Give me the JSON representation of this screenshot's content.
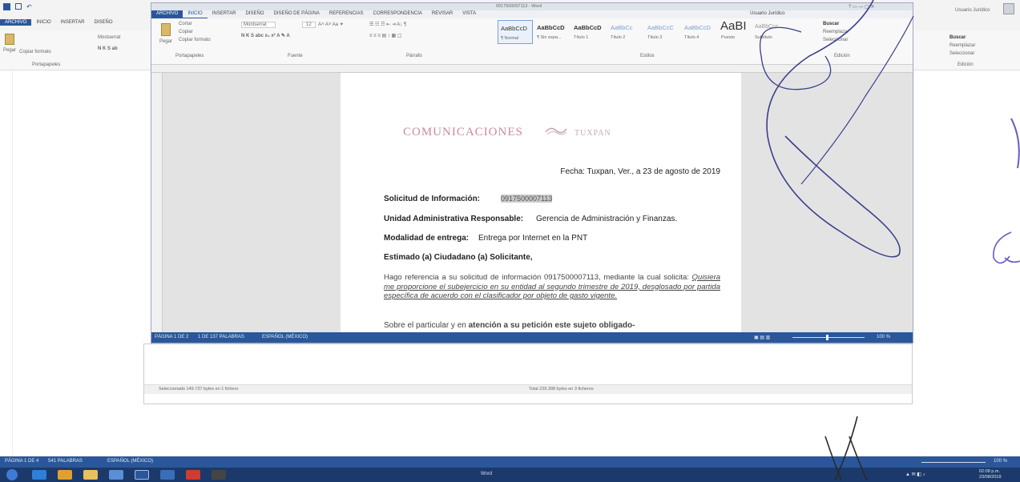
{
  "outer": {
    "tabs": [
      "ARCHIVO",
      "INICIO",
      "INSERTAR",
      "DISEÑO"
    ],
    "ribbon": {
      "paste_label": "Pegar",
      "copy_format_label": "Copiar formato",
      "font_name": "Mostserrat",
      "clipboard_group": "Portapapeles"
    },
    "right_panel": {
      "user": "Usuario Jurídico",
      "find_label": "Buscar",
      "replace_label": "Reemplazar",
      "select_label": "Seleccionar",
      "edit_group": "Edición"
    },
    "status_left": [
      "PÁGINA 1 DE 4",
      "541 PALABRAS",
      "ESPAÑOL (MÉXICO)"
    ],
    "status_right": "100 %",
    "clock": {
      "time": "02:08 p.m.",
      "date": "23/08/2019"
    },
    "taskbar_center": "Word"
  },
  "inner": {
    "window_title": "0917500007113 - Word",
    "user": "Usuario Jurídico",
    "tabs": [
      "ARCHIVO",
      "INICIO",
      "INSERTAR",
      "DISEÑO",
      "DISEÑO DE PÁGINA",
      "REFERENCIAS",
      "CORRESPONDENCIA",
      "REVISAR",
      "VISTA"
    ],
    "ribbon": {
      "paste_label": "Pegar",
      "cut_label": "Cortar",
      "copy_label": "Copiar",
      "copy_format_label": "Copiar formato",
      "font_name": "Montserrat",
      "font_size": "12",
      "clipboard_group": "Portapapeles",
      "font_group": "Fuente",
      "paragraph_group": "Párrafo",
      "styles_group": "Estilos",
      "edit_group": "Edición",
      "find_label": "Buscar",
      "replace_label": "Reemplazar",
      "select_label": "Seleccionar"
    },
    "styles": [
      {
        "preview": "AaBbCcD",
        "name": "¶ Normal"
      },
      {
        "preview": "AaBbCcD",
        "name": "¶ Sin espa..."
      },
      {
        "preview": "AaBbCcD",
        "name": "Título 1"
      },
      {
        "preview": "AaBbCc",
        "name": "Título 2"
      },
      {
        "preview": "AaBbCcC",
        "name": "Título 3"
      },
      {
        "preview": "AaBbCcD",
        "name": "Título 4"
      },
      {
        "preview": "AaBI",
        "name": "Puesto"
      },
      {
        "preview": "AaBbCcc",
        "name": "Subtítulo"
      }
    ],
    "status": {
      "page": "PÁGINA 1 DE 2",
      "words": "1 DE 137 PALABRAS",
      "lang": "ESPAÑOL (MÉXICO)",
      "zoom": "100 %"
    }
  },
  "explorer": {
    "selected": "Seleccionado 149.737 bytes en 1 fichero",
    "total": "Total 229.398 bytes en 3 ficheros"
  },
  "document": {
    "header_left": "COMUNICACIONES",
    "header_right": "TUXPAN",
    "date_line": "Fecha: Tuxpan, Ver., a 23 de agosto de 2019",
    "request_label": "Solicitud de Información:",
    "request_number": "0917500007113",
    "unit_label": "Unidad Administrativa Responsable:",
    "unit_value": "Gerencia de Administración y Finanzas.",
    "delivery_label": "Modalidad de entrega:",
    "delivery_value": "Entrega por Internet en la PNT",
    "greeting": "Estimado (a) Ciudadano (a) Solicitante,",
    "para1_start": "Hago referencia a su solicitud de información 0917500007113, mediante la cual solicita:",
    "para1_quote": "Quisiera me proporcione el subejercicio en su entidad al segundo trimestre de 2019, desglosado por partida específica de acuerdo con el clasificador por objeto de gasto vigente.",
    "para2_start": "Sobre el particular y en",
    "para2_bold": "atención a su petición este sujeto obligado-"
  }
}
